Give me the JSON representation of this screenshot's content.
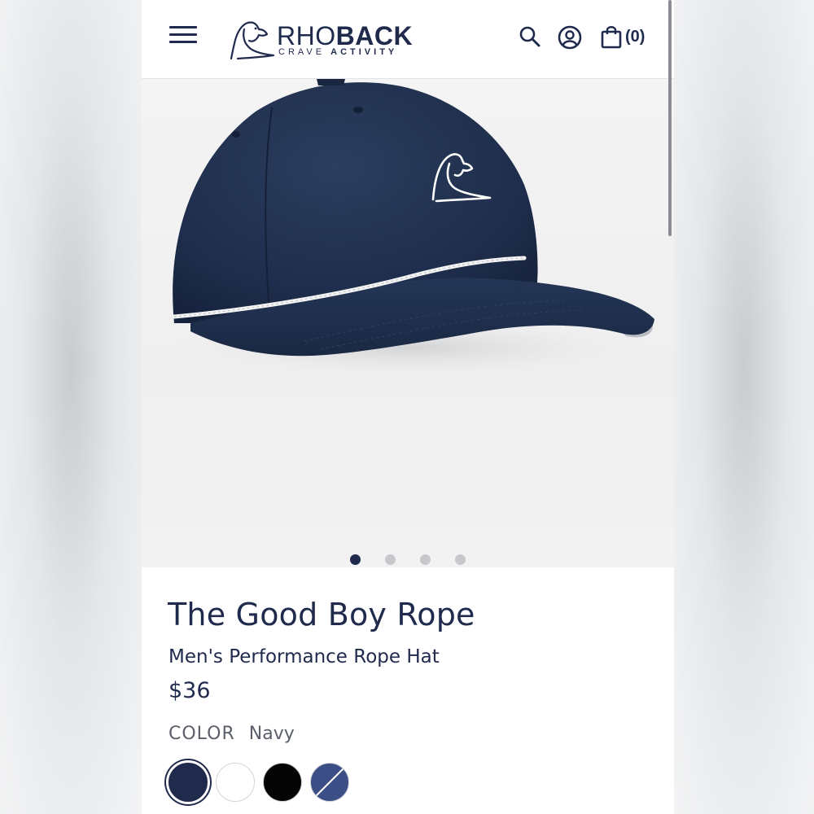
{
  "header": {
    "brand_part1": "RHO",
    "brand_part2": "BACK",
    "tagline_part1": "CRAVE ",
    "tagline_part2": "ACTIVITY",
    "cart_count": "(0)",
    "icons": [
      "menu-icon",
      "search-icon",
      "account-icon",
      "shopping-bag-icon"
    ]
  },
  "gallery": {
    "slides_total": 4,
    "active_slide": 1
  },
  "product": {
    "title": "The Good Boy Rope",
    "subtitle": "Men's Performance Rope Hat",
    "price": "$36",
    "color_label": "COLOR",
    "color_value": "Navy",
    "swatches": [
      {
        "name": "navy",
        "color": "#1f2a4d",
        "selected": true
      },
      {
        "name": "white",
        "color": "#ffffff",
        "selected": false
      },
      {
        "name": "black",
        "color": "#050505",
        "selected": false
      },
      {
        "name": "slate-blue",
        "color": "#3b4f86",
        "selected": false
      }
    ]
  },
  "colors": {
    "brand_navy": "#1f2a4d",
    "dot_inactive": "#c6c8cb"
  }
}
